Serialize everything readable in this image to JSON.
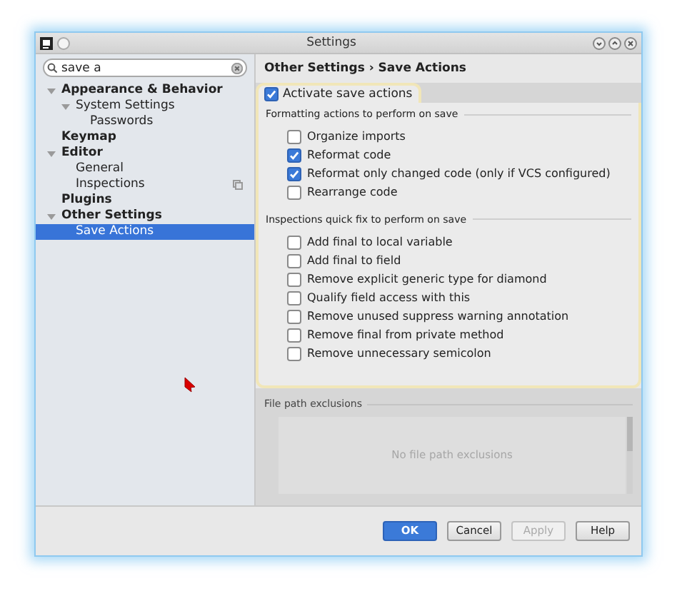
{
  "window": {
    "title": "Settings"
  },
  "search": {
    "value": "save a"
  },
  "tree": [
    {
      "label": "Appearance & Behavior",
      "expanded": true,
      "selected": false,
      "children": [
        {
          "label": "System Settings",
          "expanded": true,
          "selected": false,
          "children": [
            {
              "label": "Passwords",
              "selected": false
            }
          ]
        }
      ]
    },
    {
      "label": "Keymap",
      "selected": false
    },
    {
      "label": "Editor",
      "expanded": true,
      "selected": false,
      "children": [
        {
          "label": "General",
          "selected": false
        },
        {
          "label": "Inspections",
          "selected": false,
          "scope_icon": true
        }
      ]
    },
    {
      "label": "Plugins",
      "selected": false
    },
    {
      "label": "Other Settings",
      "expanded": true,
      "selected": false,
      "children": [
        {
          "label": "Save Actions",
          "selected": true
        }
      ]
    }
  ],
  "breadcrumb": "Other Settings › Save Actions",
  "activate": {
    "label": "Activate save actions",
    "checked": true
  },
  "sections": [
    {
      "title": "Formatting actions to perform on save",
      "options": [
        {
          "label": "Organize imports",
          "checked": false
        },
        {
          "label": "Reformat code",
          "checked": true
        },
        {
          "label": "Reformat only changed code (only if VCS configured)",
          "checked": true
        },
        {
          "label": "Rearrange code",
          "checked": false
        }
      ]
    },
    {
      "title": "Inspections quick fix to perform on save",
      "options": [
        {
          "label": "Add final to local variable",
          "checked": false
        },
        {
          "label": "Add final to field",
          "checked": false
        },
        {
          "label": "Remove explicit generic type for diamond",
          "checked": false
        },
        {
          "label": "Qualify field access with this",
          "checked": false
        },
        {
          "label": "Remove unused suppress warning annotation",
          "checked": false
        },
        {
          "label": "Remove final from private method",
          "checked": false
        },
        {
          "label": "Remove unnecessary semicolon",
          "checked": false
        }
      ]
    }
  ],
  "exclusions": {
    "title": "File path exclusions",
    "empty_text": "No file path exclusions"
  },
  "buttons": [
    {
      "label": "OK",
      "kind": "primary"
    },
    {
      "label": "Cancel",
      "kind": "normal"
    },
    {
      "label": "Apply",
      "kind": "disabled"
    },
    {
      "label": "Help",
      "kind": "normal"
    }
  ]
}
